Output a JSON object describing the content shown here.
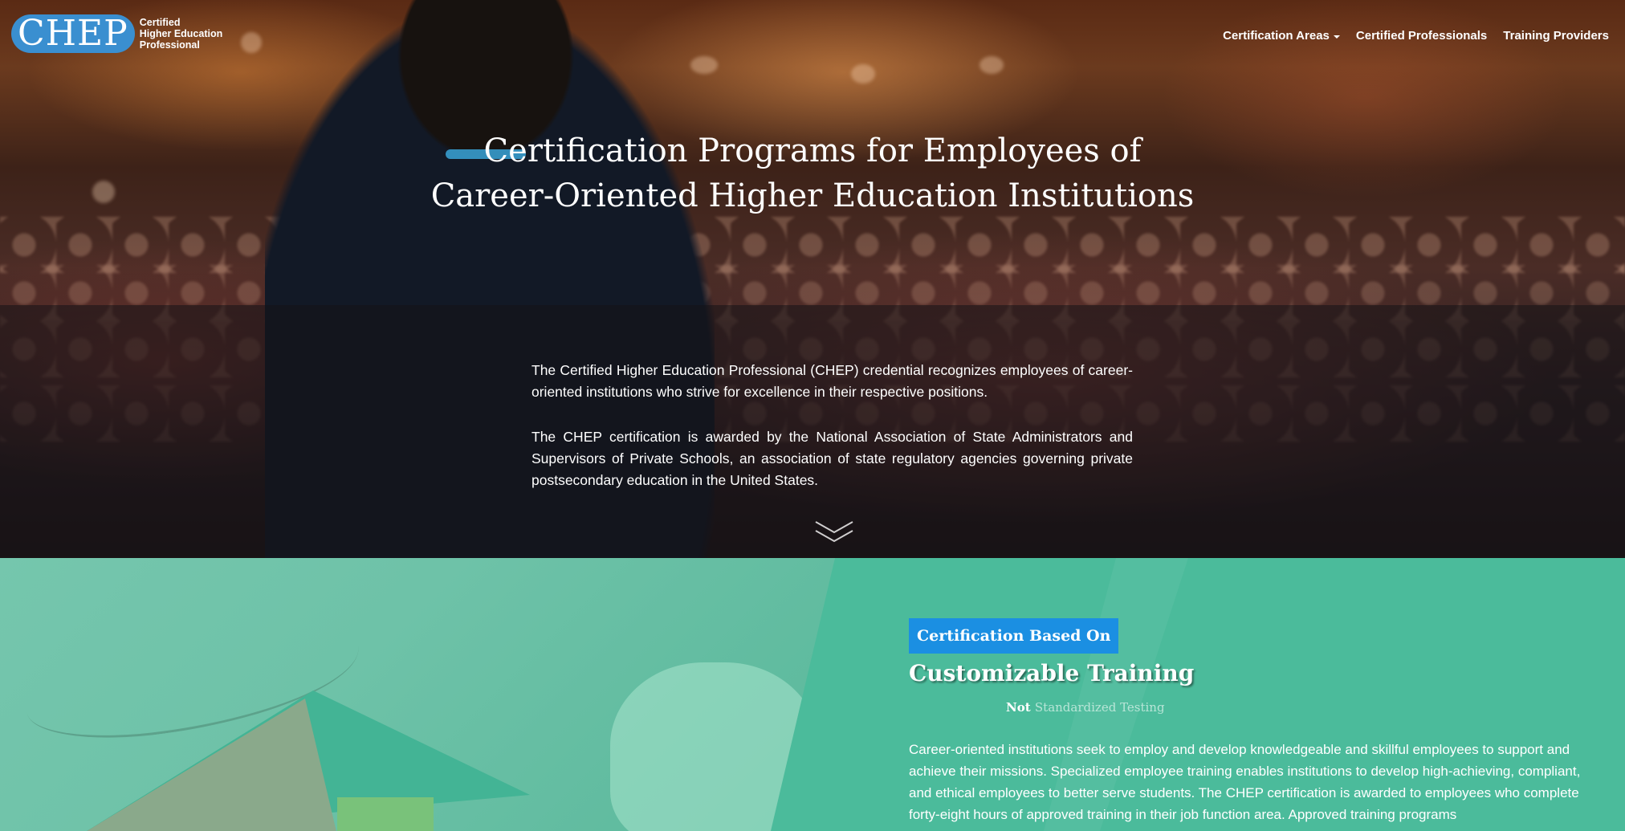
{
  "brand": {
    "logo_text": "CHEP",
    "tagline_lines": [
      "Certified",
      "Higher Education",
      "Professional"
    ]
  },
  "nav": {
    "items": [
      {
        "label": "Certification Areas",
        "has_dropdown": true
      },
      {
        "label": "Certified Professionals"
      },
      {
        "label": "Training Providers"
      }
    ]
  },
  "hero": {
    "title_line1": "Certification Programs for Employees of",
    "title_line2": "Career-Oriented Higher Education Institutions",
    "paragraph1": "The Certified Higher Education Professional (CHEP) credential recognizes employees of career-oriented institutions who strive for excellence in their respective positions.",
    "paragraph2": "The CHEP certification is awarded by the National Association of State Administrators and Supervisors of Private Schools, an association of state regulatory agencies governing private postsecondary education in the United States.",
    "scroll_icon": "double-chevron-down-icon"
  },
  "feature": {
    "badge": "Certification Based On",
    "title": "Customizable Training",
    "sub_not": "Not",
    "sub_rest": "Standardized Testing",
    "body": "Career-oriented institutions seek to employ and develop knowledgeable and skillful employees to support and achieve their missions. Specialized employee training enables institutions to develop high-achieving, compliant, and ethical employees to better serve students. The CHEP certification is awarded to employees who complete forty-eight hours of approved training in their job function area. Approved training programs"
  },
  "colors": {
    "brand_blue": "#3a8fd0",
    "badge_blue": "#1b8fe2",
    "teal": "#4bbb9b"
  }
}
